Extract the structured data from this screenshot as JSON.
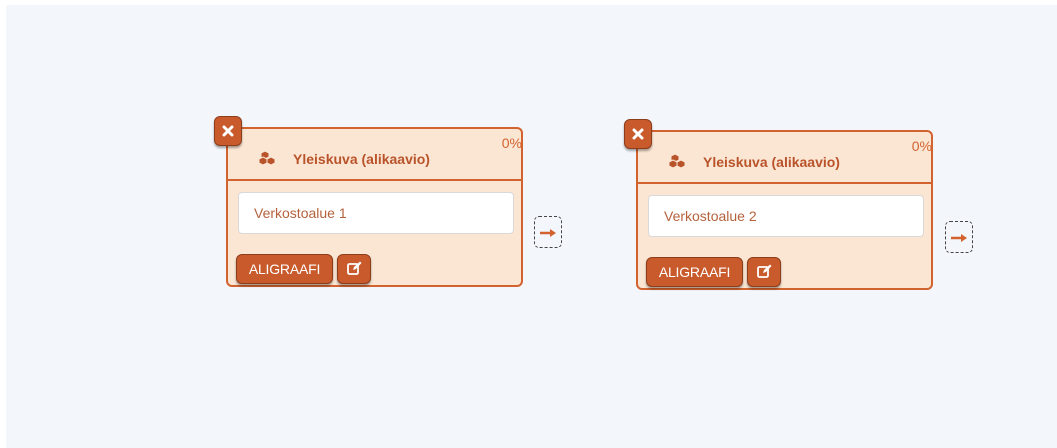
{
  "nodes": [
    {
      "title": "Yleiskuva (alikaavio)",
      "progress": "0%",
      "field_value": "Verkostoalue 1",
      "button_label": "ALIGRAAFI"
    },
    {
      "title": "Yleiskuva (alikaavio)",
      "progress": "0%",
      "field_value": "Verkostoalue 2",
      "button_label": "ALIGRAAFI"
    }
  ],
  "icons": {
    "node_icon": "cubes-icon",
    "close": "close-icon",
    "edit": "edit-icon",
    "connector": "arrow-right-icon"
  },
  "colors": {
    "canvas_background": "#f3f6fb",
    "node_fill": "#fbe6d4",
    "accent": "#d2622e",
    "button": "#c85a2c"
  }
}
